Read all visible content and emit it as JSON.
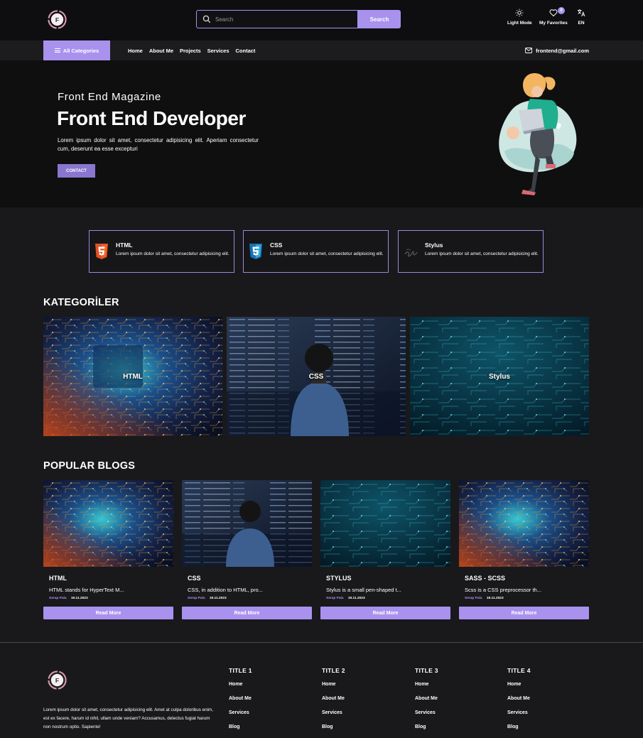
{
  "header": {
    "search_placeholder": "Search",
    "search_button": "Search",
    "light_mode_label": "Light Mode",
    "favorites_label": "My Favorites",
    "favorites_count": "0",
    "language_label": "EN",
    "logo_letter": "F"
  },
  "nav": {
    "all_categories": "All Categories",
    "links": [
      "Home",
      "About Me",
      "Projects",
      "Services",
      "Contact"
    ],
    "email": "frontend@gmail.com"
  },
  "hero": {
    "subtitle": "Front End Magazine",
    "title": "Front End Developer",
    "text": "Lorem ipsum dolor sit amet, consectetur adipisicing elit. Aperiam consectetur cum, deserunt ea esse excepturi",
    "button": "CONTACT"
  },
  "skills": [
    {
      "title": "HTML",
      "text": "Lorem ipsum dolor sit amet, consectetur adipisicing elit.",
      "icon": "html5-icon"
    },
    {
      "title": "CSS",
      "text": "Lorem ipsum dolor sit amet, consectetur adipisicing elit.",
      "icon": "css3-icon"
    },
    {
      "title": "Stylus",
      "text": "Lorem ipsum dolor sit amet, consectetur adipisicing elit.",
      "icon": "stylus-icon"
    }
  ],
  "categories": {
    "title": "KATEGORİLER",
    "items": [
      "HTML",
      "CSS",
      "Stylus"
    ]
  },
  "blogs": {
    "title": "POPULAR BLOGS",
    "items": [
      {
        "title": "HTML",
        "desc": "HTML stands for HyperText M...",
        "author": "Serap Pala",
        "date": "19.11.2023",
        "button": "Read More"
      },
      {
        "title": "CSS",
        "desc": "CSS, in addition to HTML, pro...",
        "author": "Serap Pala",
        "date": "19.11.2023",
        "button": "Read More"
      },
      {
        "title": "STYLUS",
        "desc": "Stylus is a small pen-shaped t...",
        "author": "Serap Pala",
        "date": "19.11.2023",
        "button": "Read More"
      },
      {
        "title": "SASS - SCSS",
        "desc": "Scss is a CSS preprocessor th...",
        "author": "Serap Pala",
        "date": "19.11.2023",
        "button": "Read More"
      }
    ]
  },
  "footer": {
    "text": "Lorem ipsum dolor sit amet, consectetur adipisicing elit. Amet at culpa doloribus enim, est ex facere, harum id nihil, ullam unde veniam? Accusamus, delectus fugiat harum non nostrum optio. Sapiente!",
    "columns": [
      {
        "title": "TITLE 1",
        "links": [
          "Home",
          "About Me",
          "Services",
          "Blog"
        ]
      },
      {
        "title": "TITLE 2",
        "links": [
          "Home",
          "About Me",
          "Services",
          "Blog"
        ]
      },
      {
        "title": "TITLE 3",
        "links": [
          "Home",
          "About Me",
          "Services",
          "Blog"
        ]
      },
      {
        "title": "TITLE 4",
        "links": [
          "Home",
          "About Me",
          "Services",
          "Blog"
        ]
      }
    ]
  },
  "colors": {
    "accent": "#a892ee",
    "accent_dark": "#8a76cf",
    "background": "#19191b",
    "header_bg": "#0e0e10"
  }
}
